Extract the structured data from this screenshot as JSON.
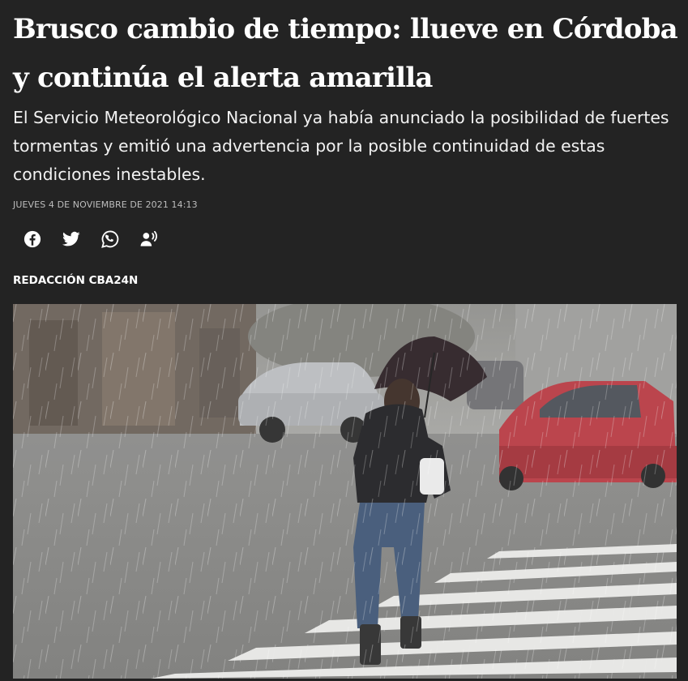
{
  "article": {
    "headline": "Brusco cambio de tiempo: llueve en Córdoba y continúa el alerta amarilla",
    "subtitle": "El Servicio Meteorológico Nacional ya había anunciado la posibilidad de fuertes tormentas y emitió una advertencia por la posible continuidad de estas condiciones inestables.",
    "dateline": "JUEVES 4 DE NOVIEMBRE DE 2021 14:13",
    "author": "REDACCIÓN CBA24N"
  },
  "share_buttons": [
    {
      "icon": "facebook-icon"
    },
    {
      "icon": "twitter-icon"
    },
    {
      "icon": "whatsapp-icon"
    },
    {
      "icon": "listen-audio-icon"
    }
  ],
  "photo": {
    "subject": "woman with umbrella crossing street in heavy rain"
  },
  "colors": {
    "background": "#232323",
    "text": "#ffffff",
    "muted": "#bdbdbd"
  }
}
